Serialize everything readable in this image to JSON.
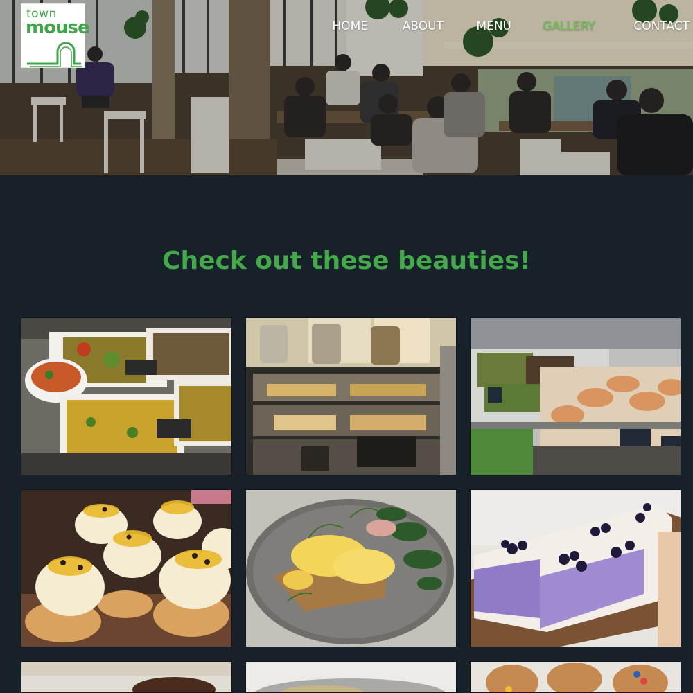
{
  "logo": {
    "line1": "town",
    "line2": "mouse"
  },
  "nav": {
    "items": [
      {
        "label": "HOME",
        "active": false
      },
      {
        "label": "ABOUT",
        "active": false
      },
      {
        "label": "MENU",
        "active": false
      },
      {
        "label": "GALLERY",
        "active": true
      },
      {
        "label": "CONTACT",
        "active": false
      }
    ]
  },
  "colors": {
    "accent": "#45a84b",
    "nav_active": "#6cc74a",
    "background": "#16212a"
  },
  "gallery": {
    "heading": "Check out these beauties!",
    "photos": [
      "salad-bar-photo",
      "cake-display-cabinet-photo",
      "deli-counter-photo",
      "passionfruit-cupcakes-photo",
      "eggs-benedict-photo",
      "blueberry-slice-photo",
      "photo-partial-1",
      "photo-partial-2",
      "gingerbread-biscuits-photo"
    ]
  }
}
